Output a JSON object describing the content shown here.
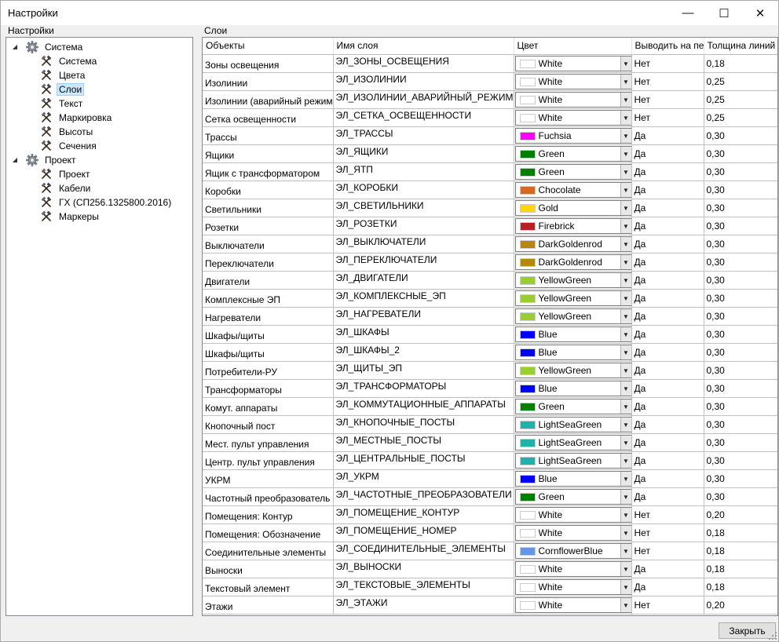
{
  "window": {
    "title": "Настройки",
    "min_glyph": "—",
    "max_glyph": "☐",
    "close_glyph": "✕"
  },
  "left_panel": {
    "label": "Настройки"
  },
  "right_panel": {
    "label": "Слои"
  },
  "tree": [
    {
      "label": "Система",
      "level": 0,
      "icon": "gear-icon",
      "expanded": true
    },
    {
      "label": "Система",
      "level": 1,
      "icon": "tools-icon"
    },
    {
      "label": "Цвета",
      "level": 1,
      "icon": "tools-icon"
    },
    {
      "label": "Слои",
      "level": 1,
      "icon": "tools-icon",
      "selected": true
    },
    {
      "label": "Текст",
      "level": 1,
      "icon": "tools-icon"
    },
    {
      "label": "Маркировка",
      "level": 1,
      "icon": "tools-icon"
    },
    {
      "label": "Высоты",
      "level": 1,
      "icon": "tools-icon"
    },
    {
      "label": "Сечения",
      "level": 1,
      "icon": "tools-icon"
    },
    {
      "label": "Проект",
      "level": 0,
      "icon": "gear-icon",
      "expanded": true
    },
    {
      "label": "Проект",
      "level": 1,
      "icon": "tools-icon"
    },
    {
      "label": "Кабели",
      "level": 1,
      "icon": "tools-icon"
    },
    {
      "label": "ГХ (СП256.1325800.2016)",
      "level": 1,
      "icon": "tools-icon"
    },
    {
      "label": "Маркеры",
      "level": 1,
      "icon": "tools-icon"
    }
  ],
  "grid": {
    "columns": [
      "Объекты",
      "Имя слоя",
      "Цвет",
      "Выводить на пе",
      "Толщина линий"
    ],
    "rows": [
      {
        "object": "Зоны освещения",
        "layer": "ЭЛ_ЗОНЫ_ОСВЕЩЕНИЯ",
        "color": "White",
        "hex": "#ffffff",
        "print": "Нет",
        "width": "0,18"
      },
      {
        "object": "Изолинии",
        "layer": "ЭЛ_ИЗОЛИНИИ",
        "color": "White",
        "hex": "#ffffff",
        "print": "Нет",
        "width": "0,25"
      },
      {
        "object": "Изолинии (аварийный режим)",
        "layer": "ЭЛ_ИЗОЛИНИИ_АВАРИЙНЫЙ_РЕЖИМ",
        "color": "White",
        "hex": "#ffffff",
        "print": "Нет",
        "width": "0,25"
      },
      {
        "object": "Сетка освещенности",
        "layer": "ЭЛ_СЕТКА_ОСВЕЩЕННОСТИ",
        "color": "White",
        "hex": "#ffffff",
        "print": "Нет",
        "width": "0,25"
      },
      {
        "object": "Трассы",
        "layer": "ЭЛ_ТРАССЫ",
        "color": "Fuchsia",
        "hex": "#ff00ff",
        "print": "Да",
        "width": "0,30"
      },
      {
        "object": "Ящики",
        "layer": "ЭЛ_ЯЩИКИ",
        "color": "Green",
        "hex": "#008000",
        "print": "Да",
        "width": "0,30"
      },
      {
        "object": "Ящик с трансформатором",
        "layer": "ЭЛ_ЯТП",
        "color": "Green",
        "hex": "#008000",
        "print": "Да",
        "width": "0,30"
      },
      {
        "object": "Коробки",
        "layer": "ЭЛ_КОРОБКИ",
        "color": "Chocolate",
        "hex": "#d2691e",
        "print": "Да",
        "width": "0,30"
      },
      {
        "object": "Светильники",
        "layer": "ЭЛ_СВЕТИЛЬНИКИ",
        "color": "Gold",
        "hex": "#ffd700",
        "print": "Да",
        "width": "0,30"
      },
      {
        "object": "Розетки",
        "layer": "ЭЛ_РОЗЕТКИ",
        "color": "Firebrick",
        "hex": "#b22222",
        "print": "Да",
        "width": "0,30"
      },
      {
        "object": "Выключатели",
        "layer": "ЭЛ_ВЫКЛЮЧАТЕЛИ",
        "color": "DarkGoldenrod",
        "hex": "#b8860b",
        "print": "Да",
        "width": "0,30"
      },
      {
        "object": "Переключатели",
        "layer": "ЭЛ_ПЕРЕКЛЮЧАТЕЛИ",
        "color": "DarkGoldenrod",
        "hex": "#b8860b",
        "print": "Да",
        "width": "0,30"
      },
      {
        "object": "Двигатели",
        "layer": "ЭЛ_ДВИГАТЕЛИ",
        "color": "YellowGreen",
        "hex": "#9acd32",
        "print": "Да",
        "width": "0,30"
      },
      {
        "object": "Комплексные ЭП",
        "layer": "ЭЛ_КОМПЛЕКСНЫЕ_ЭП",
        "color": "YellowGreen",
        "hex": "#9acd32",
        "print": "Да",
        "width": "0,30"
      },
      {
        "object": "Нагреватели",
        "layer": "ЭЛ_НАГРЕВАТЕЛИ",
        "color": "YellowGreen",
        "hex": "#9acd32",
        "print": "Да",
        "width": "0,30"
      },
      {
        "object": "Шкафы/щиты",
        "layer": "ЭЛ_ШКАФЫ",
        "color": "Blue",
        "hex": "#0000ff",
        "print": "Да",
        "width": "0,30"
      },
      {
        "object": "Шкафы/щиты",
        "layer": "ЭЛ_ШКАФЫ_2",
        "color": "Blue",
        "hex": "#0000ff",
        "print": "Да",
        "width": "0,30"
      },
      {
        "object": "Потребители-РУ",
        "layer": "ЭЛ_ЩИТЫ_ЭП",
        "color": "YellowGreen",
        "hex": "#9acd32",
        "print": "Да",
        "width": "0,30"
      },
      {
        "object": "Трансформаторы",
        "layer": "ЭЛ_ТРАНСФОРМАТОРЫ",
        "color": "Blue",
        "hex": "#0000ff",
        "print": "Да",
        "width": "0,30"
      },
      {
        "object": "Комут. аппараты",
        "layer": "ЭЛ_КОММУТАЦИОННЫЕ_АППАРАТЫ",
        "color": "Green",
        "hex": "#008000",
        "print": "Да",
        "width": "0,30"
      },
      {
        "object": "Кнопочный пост",
        "layer": "ЭЛ_КНОПОЧНЫЕ_ПОСТЫ",
        "color": "LightSeaGreen",
        "hex": "#20b2aa",
        "print": "Да",
        "width": "0,30"
      },
      {
        "object": "Мест. пульт управления",
        "layer": "ЭЛ_МЕСТНЫЕ_ПОСТЫ",
        "color": "LightSeaGreen",
        "hex": "#20b2aa",
        "print": "Да",
        "width": "0,30"
      },
      {
        "object": "Центр. пульт управления",
        "layer": "ЭЛ_ЦЕНТРАЛЬНЫЕ_ПОСТЫ",
        "color": "LightSeaGreen",
        "hex": "#20b2aa",
        "print": "Да",
        "width": "0,30"
      },
      {
        "object": "УКРМ",
        "layer": "ЭЛ_УКРМ",
        "color": "Blue",
        "hex": "#0000ff",
        "print": "Да",
        "width": "0,30"
      },
      {
        "object": "Частотный преобразователь",
        "layer": "ЭЛ_ЧАСТОТНЫЕ_ПРЕОБРАЗОВАТЕЛИ",
        "color": "Green",
        "hex": "#008000",
        "print": "Да",
        "width": "0,30"
      },
      {
        "object": "Помещения: Контур",
        "layer": "ЭЛ_ПОМЕЩЕНИЕ_КОНТУР",
        "color": "White",
        "hex": "#ffffff",
        "print": "Нет",
        "width": "0,20"
      },
      {
        "object": "Помещения: Обозначение",
        "layer": "ЭЛ_ПОМЕЩЕНИЕ_НОМЕР",
        "color": "White",
        "hex": "#ffffff",
        "print": "Нет",
        "width": "0,18"
      },
      {
        "object": "Соединительные элементы",
        "layer": "ЭЛ_СОЕДИНИТЕЛЬНЫЕ_ЭЛЕМЕНТЫ",
        "color": "CornflowerBlue",
        "hex": "#6495ed",
        "print": "Нет",
        "width": "0,18"
      },
      {
        "object": "Выноски",
        "layer": "ЭЛ_ВЫНОСКИ",
        "color": "White",
        "hex": "#ffffff",
        "print": "Да",
        "width": "0,18"
      },
      {
        "object": "Текстовый элемент",
        "layer": "ЭЛ_ТЕКСТОВЫЕ_ЭЛЕМЕНТЫ",
        "color": "White",
        "hex": "#ffffff",
        "print": "Да",
        "width": "0,18"
      },
      {
        "object": "Этажи",
        "layer": "ЭЛ_ЭТАЖИ",
        "color": "White",
        "hex": "#ffffff",
        "print": "Нет",
        "width": "0,20"
      }
    ]
  },
  "footer": {
    "close_label": "Закрыть"
  },
  "colors": {
    "selection_bg": "#cce8ff",
    "selection_border": "#99d1ff"
  }
}
